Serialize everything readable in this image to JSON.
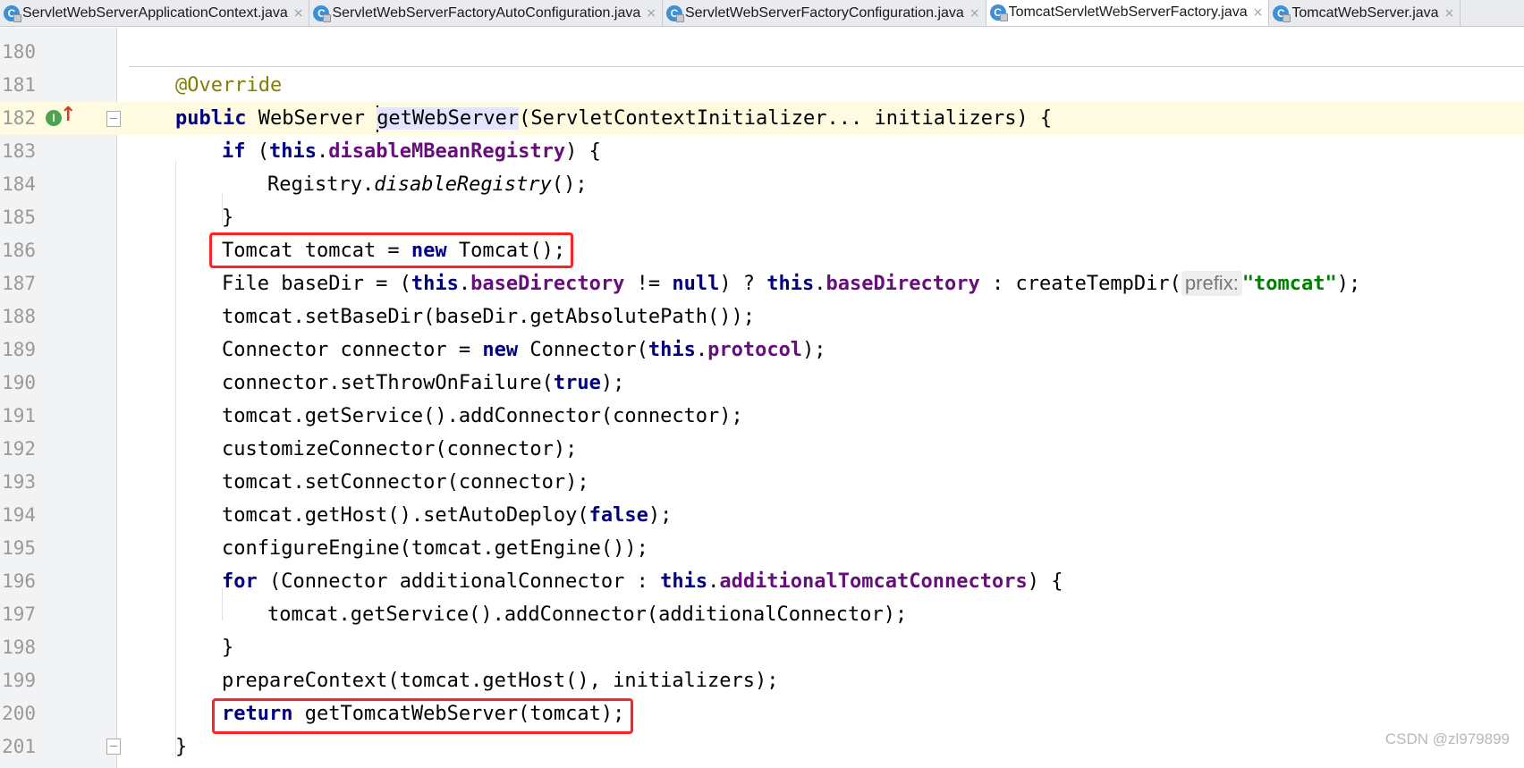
{
  "tabs": [
    {
      "label": "ServletWebServerApplicationContext.java",
      "icon": "java-class-icon",
      "active": false
    },
    {
      "label": "ServletWebServerFactoryAutoConfiguration.java",
      "icon": "java-class-icon",
      "active": false
    },
    {
      "label": "ServletWebServerFactoryConfiguration.java",
      "icon": "java-class-icon",
      "active": false
    },
    {
      "label": "TomcatServletWebServerFactory.java",
      "icon": "java-class-icon",
      "active": true
    },
    {
      "label": "TomcatWebServer.java",
      "icon": "java-class-icon",
      "active": false
    }
  ],
  "tab_icon_letter": "C",
  "tab_close_glyph": "×",
  "gutter": {
    "implements_icon_letter": "I",
    "override_arrow_glyph": "↑"
  },
  "line_numbers": [
    "180",
    "181",
    "182",
    "183",
    "184",
    "185",
    "186",
    "187",
    "188",
    "189",
    "190",
    "191",
    "192",
    "193",
    "194",
    "195",
    "196",
    "197",
    "198",
    "199",
    "200",
    "201"
  ],
  "code": {
    "l181": {
      "annotation": "@Override"
    },
    "l182": {
      "kw1": "public",
      "t1": " WebServer ",
      "method": "getWebServer",
      "t2": "(ServletContextInitializer... initializers) {"
    },
    "l183": {
      "kw1": "if",
      "t1": " (",
      "kw2": "this",
      "t2": ".",
      "field": "disableMBeanRegistry",
      "t3": ") {"
    },
    "l184": {
      "t1": "Registry.",
      "italic": "disableRegistry",
      "t2": "();"
    },
    "l185": {
      "t1": "}"
    },
    "l186": {
      "t1": "Tomcat tomcat = ",
      "kw1": "new",
      "t2": " Tomcat();"
    },
    "l187": {
      "t1": "File baseDir = (",
      "kw1": "this",
      "t2": ".",
      "field1": "baseDirectory",
      "t3": " != ",
      "kw2": "null",
      "t4": ") ? ",
      "kw3": "this",
      "t5": ".",
      "field2": "baseDirectory",
      "t6": " : createTempDir(",
      "hint": "prefix:",
      "str": "\"tomcat\"",
      "t7": ");"
    },
    "l188": {
      "t1": "tomcat.setBaseDir(baseDir.getAbsolutePath());"
    },
    "l189": {
      "t1": "Connector connector = ",
      "kw1": "new",
      "t2": " Connector(",
      "kw2": "this",
      "t3": ".",
      "field": "protocol",
      "t4": ");"
    },
    "l190": {
      "t1": "connector.setThrowOnFailure(",
      "kw1": "true",
      "t2": ");"
    },
    "l191": {
      "t1": "tomcat.getService().addConnector(connector);"
    },
    "l192": {
      "t1": "customizeConnector(connector);"
    },
    "l193": {
      "t1": "tomcat.setConnector(connector);"
    },
    "l194": {
      "t1": "tomcat.getHost().setAutoDeploy(",
      "kw1": "false",
      "t2": ");"
    },
    "l195": {
      "t1": "configureEngine(tomcat.getEngine());"
    },
    "l196": {
      "kw1": "for",
      "t1": " (Connector additionalConnector : ",
      "kw2": "this",
      "t2": ".",
      "field": "additionalTomcatConnectors",
      "t3": ") {"
    },
    "l197": {
      "t1": "tomcat.getService().addConnector(additionalConnector);"
    },
    "l198": {
      "t1": "}"
    },
    "l199": {
      "t1": "prepareContext(tomcat.getHost(), initializers);"
    },
    "l200": {
      "kw1": "return",
      "t1": " getTomcatWebServer(tomcat);"
    },
    "l201": {
      "t1": "}"
    }
  },
  "watermark": "CSDN @zl979899",
  "colors": {
    "keyword": "#000080",
    "field": "#660e7a",
    "annotation": "#808000",
    "string": "#008000",
    "highlight_box": "#ff2222",
    "current_line": "#fffbe0"
  }
}
